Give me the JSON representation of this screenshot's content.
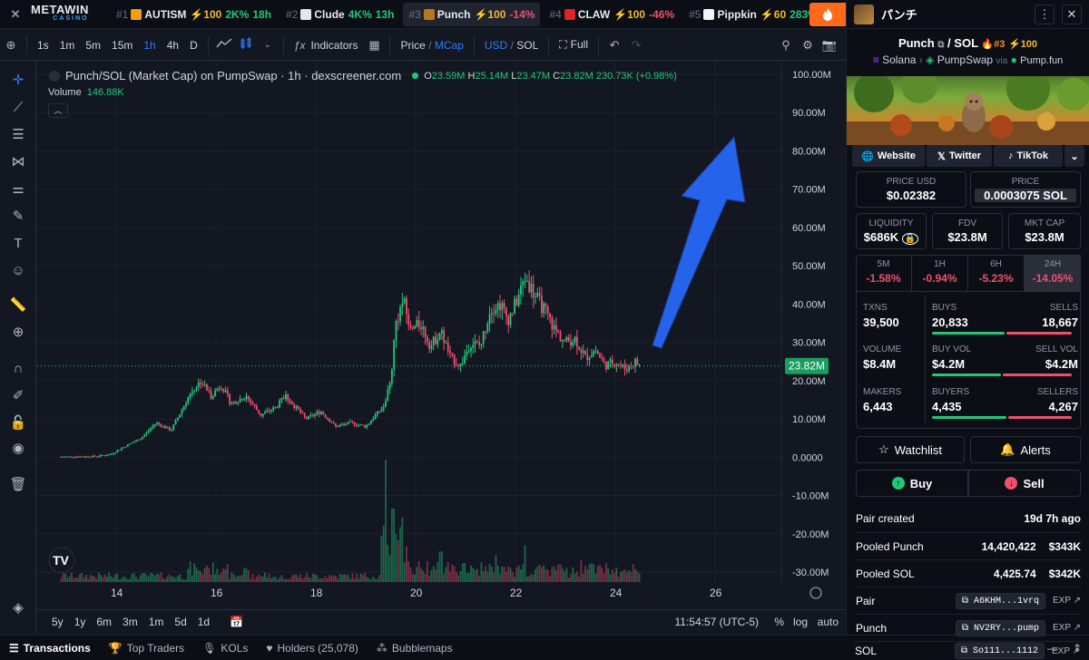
{
  "ticker": {
    "brand_main": "METAWIN",
    "brand_sub": "CASINO",
    "items": [
      {
        "rank": "#1",
        "name": "AUTISM",
        "boost": "⚡100",
        "change": "2K%",
        "change_class": "pos",
        "age": "18h",
        "avatar_color": "#f59e0b"
      },
      {
        "rank": "#2",
        "name": "Clude",
        "boost": "",
        "change": "4K%",
        "change_class": "pos",
        "age": "13h",
        "avatar_color": "#e5e7eb"
      },
      {
        "rank": "#3",
        "name": "Punch",
        "boost": "⚡100",
        "change": "-14%",
        "change_class": "neg",
        "age": "",
        "avatar_color": "#b7791f"
      },
      {
        "rank": "#4",
        "name": "CLAW",
        "boost": "⚡100",
        "change": "-46%",
        "change_class": "neg",
        "age": "",
        "avatar_color": "#dc2626"
      },
      {
        "rank": "#5",
        "name": "Pippkin",
        "boost": "⚡60",
        "change": "283%",
        "change_class": "pos",
        "age": "",
        "avatar_color": "#f3f4f6"
      }
    ]
  },
  "toolbar": {
    "intervals": [
      "1s",
      "1m",
      "5m",
      "15m",
      "1h",
      "4h",
      "D"
    ],
    "selected_interval": "1h",
    "indicators": "Indicators",
    "price_label": "Price",
    "mcap_label": "MCap",
    "usd_label": "USD",
    "sol_label": "SOL",
    "full_label": "Full",
    "slash": "/"
  },
  "chart": {
    "legend_title": "Punch/SOL (Market Cap) on PumpSwap · 1h · dexscreener.com",
    "ohlc_o": "23.59M",
    "ohlc_h": "25.14M",
    "ohlc_l": "23.47M",
    "ohlc_c": "23.82M",
    "ohlc_change": "230.73K (+0.98%)",
    "volume_label": "Volume",
    "volume_value": "146.88K",
    "current_price_tag": "23.82M",
    "watermark": "TV"
  },
  "chart_data": {
    "type": "candlestick",
    "title": "Punch/SOL (Market Cap) on PumpSwap · 1h · dexscreener.com",
    "x_ticks": [
      "14",
      "16",
      "18",
      "20",
      "22",
      "24",
      "26"
    ],
    "y_ticks": [
      "100.00M",
      "90.00M",
      "80.00M",
      "70.00M",
      "60.00M",
      "50.00M",
      "40.00M",
      "30.00M",
      "20.00M",
      "10.00M",
      "0.0000",
      "-10.00M",
      "-20.00M",
      "-30.00M"
    ],
    "ylim": [
      -30,
      100
    ],
    "y_unit": "M",
    "current_value": 23.82,
    "price_path": [
      [
        12.9,
        0.1
      ],
      [
        13.2,
        0.15
      ],
      [
        13.6,
        0.2
      ],
      [
        13.9,
        0.8
      ],
      [
        14.2,
        3
      ],
      [
        14.5,
        5
      ],
      [
        14.8,
        9
      ],
      [
        15.1,
        7
      ],
      [
        15.3,
        12
      ],
      [
        15.5,
        17
      ],
      [
        15.7,
        20
      ],
      [
        15.9,
        16
      ],
      [
        16.1,
        19
      ],
      [
        16.3,
        14
      ],
      [
        16.6,
        16
      ],
      [
        16.9,
        11
      ],
      [
        17.2,
        13
      ],
      [
        17.4,
        16
      ],
      [
        17.6,
        13
      ],
      [
        17.8,
        10
      ],
      [
        18.1,
        12
      ],
      [
        18.4,
        8
      ],
      [
        18.7,
        9
      ],
      [
        19.0,
        8
      ],
      [
        19.2,
        11
      ],
      [
        19.35,
        13
      ],
      [
        19.5,
        20
      ],
      [
        19.6,
        35
      ],
      [
        19.75,
        41
      ],
      [
        19.9,
        33
      ],
      [
        20.1,
        35
      ],
      [
        20.3,
        29
      ],
      [
        20.5,
        33
      ],
      [
        20.7,
        26
      ],
      [
        20.9,
        24
      ],
      [
        21.1,
        30
      ],
      [
        21.3,
        29
      ],
      [
        21.5,
        39
      ],
      [
        21.7,
        40
      ],
      [
        21.85,
        36
      ],
      [
        22.0,
        40
      ],
      [
        22.2,
        47
      ],
      [
        22.4,
        42
      ],
      [
        22.6,
        38
      ],
      [
        22.8,
        33
      ],
      [
        23.0,
        30
      ],
      [
        23.2,
        31
      ],
      [
        23.4,
        26
      ],
      [
        23.6,
        28
      ],
      [
        23.8,
        24
      ],
      [
        24.0,
        25
      ],
      [
        24.2,
        23
      ],
      [
        24.4,
        25
      ],
      [
        24.5,
        23.8
      ]
    ],
    "volume_spikes": [
      [
        19.4,
        100
      ],
      [
        19.55,
        60
      ],
      [
        19.7,
        45
      ],
      [
        20.5,
        25
      ],
      [
        21.6,
        22
      ],
      [
        22.2,
        30
      ],
      [
        23.5,
        15
      ]
    ],
    "annotation": "blue up arrow"
  },
  "bottom_ranges": [
    "5y",
    "1y",
    "6m",
    "3m",
    "1m",
    "5d",
    "1d"
  ],
  "bottom_clock": "11:54:57 (UTC-5)",
  "bottom_opts": {
    "pct": "%",
    "log": "log",
    "auto": "auto"
  },
  "bottom_tabs": [
    {
      "label": "Transactions",
      "icon": "list-icon"
    },
    {
      "label": "Top Traders",
      "icon": "trophy-icon"
    },
    {
      "label": "KOLs",
      "icon": "mic-icon"
    },
    {
      "label": "Holders (25,078)",
      "icon": "heart-icon"
    },
    {
      "label": "Bubblemaps",
      "icon": "bubbles-icon"
    }
  ],
  "panel": {
    "token_name": "パンチ",
    "pair_base": "Punch",
    "pair_quote": "SOL",
    "rank": "#3",
    "boost": "100",
    "chain": "Solana",
    "dex": "PumpSwap",
    "via": "via",
    "launchpad": "Pump.fun",
    "links": {
      "website": "Website",
      "twitter": "Twitter",
      "tiktok": "TikTok"
    },
    "price_usd_label": "PRICE USD",
    "price_usd": "$0.02382",
    "price_label": "PRICE",
    "price_sol": "0.0003075 SOL",
    "liquidity_label": "LIQUIDITY",
    "liquidity": "$686K",
    "fdv_label": "FDV",
    "fdv": "$23.8M",
    "mcap_label": "MKT CAP",
    "mcap": "$23.8M",
    "changes": [
      {
        "label": "5M",
        "value": "-1.58%"
      },
      {
        "label": "1H",
        "value": "-0.94%"
      },
      {
        "label": "6H",
        "value": "-5.23%"
      },
      {
        "label": "24H",
        "value": "-14.05%"
      }
    ],
    "txns_label": "TXNS",
    "txns": "39,500",
    "buys_label": "BUYS",
    "buys": "20,833",
    "sells_label": "SELLS",
    "sells": "18,667",
    "volume_label": "VOLUME",
    "volume": "$8.4M",
    "buyvol_label": "BUY VOL",
    "buyvol": "$4.2M",
    "sellvol_label": "SELL VOL",
    "sellvol": "$4.2M",
    "makers_label": "MAKERS",
    "makers": "6,443",
    "buyers_label": "BUYERS",
    "buyers": "4,435",
    "sellers_label": "SELLERS",
    "sellers": "4,267",
    "watchlist": "Watchlist",
    "alerts": "Alerts",
    "buy": "Buy",
    "sell": "Sell",
    "pair_created_label": "Pair created",
    "pair_created": "19d 7h ago",
    "pooled_punch_label": "Pooled Punch",
    "pooled_punch": "14,420,422",
    "pooled_punch_usd": "$343K",
    "pooled_sol_label": "Pooled SOL",
    "pooled_sol": "4,425.74",
    "pooled_sol_usd": "$342K",
    "pair_label": "Pair",
    "pair_addr": "A6KHM...1vrq",
    "punch_label": "Punch",
    "punch_addr": "NV2RY...pump",
    "sol_label": "SOL",
    "sol_addr": "So111...1112",
    "exp": "EXP"
  },
  "colors": {
    "up": "#23c77a",
    "down": "#f0506e",
    "accent": "#2f7cf6",
    "arrow": "#2563eb"
  }
}
